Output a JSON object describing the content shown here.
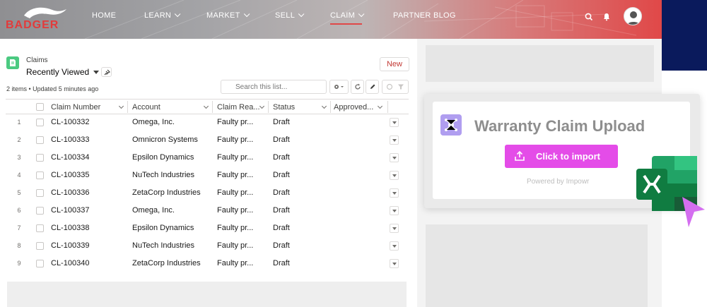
{
  "brand": {
    "logo_text": "BADGER"
  },
  "nav": {
    "items": [
      {
        "label": "HOME",
        "has_menu": false
      },
      {
        "label": "LEARN",
        "has_menu": true
      },
      {
        "label": "MARKET",
        "has_menu": true
      },
      {
        "label": "SELL",
        "has_menu": true
      },
      {
        "label": "CLAIM",
        "has_menu": true,
        "active": true
      },
      {
        "label": "PARTNER BLOG",
        "has_menu": false
      }
    ],
    "icons": [
      "search-icon",
      "bell-icon",
      "user-avatar"
    ]
  },
  "list_view": {
    "object_label": "Claims",
    "view_name": "Recently Viewed",
    "new_button": "New",
    "meta": "2 items • Updated 5 minutes ago",
    "search_placeholder": "Search this list...",
    "columns": [
      "Claim Number",
      "Account",
      "Claim Rea...",
      "Status",
      "Approved..."
    ],
    "rows": [
      {
        "n": "1",
        "claim": "CL-100332",
        "account": "Omega, Inc.",
        "reason": "Faulty pr...",
        "status": "Draft"
      },
      {
        "n": "2",
        "claim": "CL-100333",
        "account": "Omnicron Systems",
        "reason": "Faulty pr...",
        "status": "Draft"
      },
      {
        "n": "3",
        "claim": "CL-100334",
        "account": "Epsilon Dynamics",
        "reason": "Faulty pr...",
        "status": "Draft"
      },
      {
        "n": "4",
        "claim": "CL-100335",
        "account": "NuTech Industries",
        "reason": "Faulty pr...",
        "status": "Draft"
      },
      {
        "n": "5",
        "claim": "CL-100336",
        "account": "ZetaCorp Industries",
        "reason": "Faulty pr...",
        "status": "Draft"
      },
      {
        "n": "6",
        "claim": "CL-100337",
        "account": "Omega, Inc.",
        "reason": "Faulty pr...",
        "status": "Draft"
      },
      {
        "n": "7",
        "claim": "CL-100338",
        "account": "Epsilon Dynamics",
        "reason": "Faulty pr...",
        "status": "Draft"
      },
      {
        "n": "8",
        "claim": "CL-100339",
        "account": "NuTech Industries",
        "reason": "Faulty pr...",
        "status": "Draft"
      },
      {
        "n": "9",
        "claim": "CL-100340",
        "account": "ZetaCorp Industries",
        "reason": "Faulty pr...",
        "status": "Draft"
      }
    ]
  },
  "upload_widget": {
    "title": "Warranty Claim Upload",
    "button": "Click to import",
    "powered_by": "Powered by Impowr",
    "accent_color": "#e44ce8"
  },
  "colors": {
    "header_red": "#e04848",
    "brand_red": "#e23b3b",
    "navy": "#0a1a5c",
    "excel_green": "#1d6f42"
  }
}
